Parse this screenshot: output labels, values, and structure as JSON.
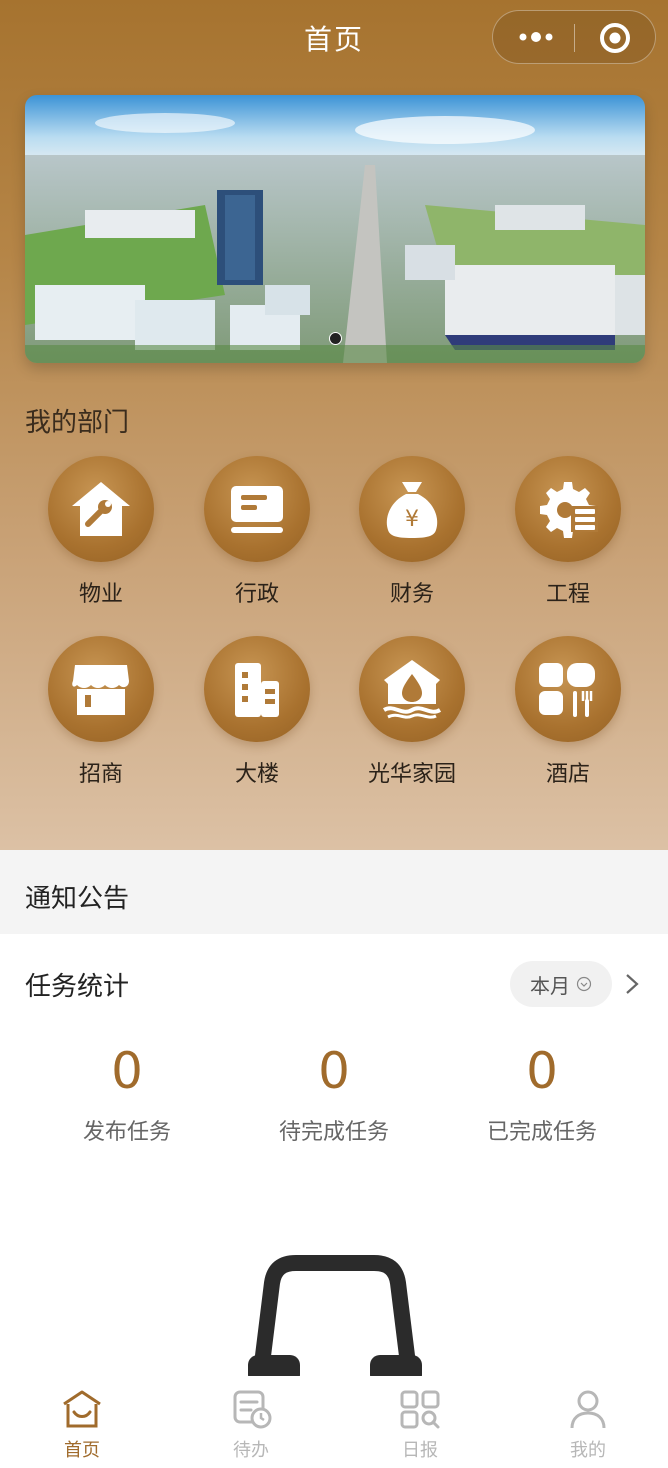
{
  "header": {
    "title": "首页"
  },
  "capsule": {
    "more_icon": "more-dots-icon",
    "close_icon": "target-circle-icon"
  },
  "banner": {
    "image": "aerial-industrial-park-photo",
    "active_dot": 1
  },
  "departments": {
    "title": "我的部门",
    "items": [
      {
        "label": "物业",
        "icon": "house-wrench-icon"
      },
      {
        "label": "行政",
        "icon": "document-card-icon"
      },
      {
        "label": "财务",
        "icon": "money-bag-icon"
      },
      {
        "label": "工程",
        "icon": "gear-icon"
      },
      {
        "label": "招商",
        "icon": "storefront-icon"
      },
      {
        "label": "大楼",
        "icon": "building-icon"
      },
      {
        "label": "光华家园",
        "icon": "home-drop-icon"
      },
      {
        "label": "酒店",
        "icon": "cutlery-icon"
      }
    ]
  },
  "notice": {
    "title": "通知公告"
  },
  "stats": {
    "title": "任务统计",
    "period": "本月",
    "items": [
      {
        "value": "0",
        "label": "发布任务"
      },
      {
        "value": "0",
        "label": "待完成任务"
      },
      {
        "value": "0",
        "label": "已完成任务"
      }
    ]
  },
  "tabbar": {
    "items": [
      {
        "label": "首页",
        "icon": "home-icon",
        "active": true
      },
      {
        "label": "待办",
        "icon": "todo-clock-icon",
        "active": false
      },
      {
        "label": "日报",
        "icon": "grid-search-icon",
        "active": false
      },
      {
        "label": "我的",
        "icon": "user-icon",
        "active": false
      }
    ]
  },
  "colors": {
    "accent": "#a06b2c",
    "hero_top": "#a6732f",
    "hero_bottom": "#dcc1a5"
  }
}
